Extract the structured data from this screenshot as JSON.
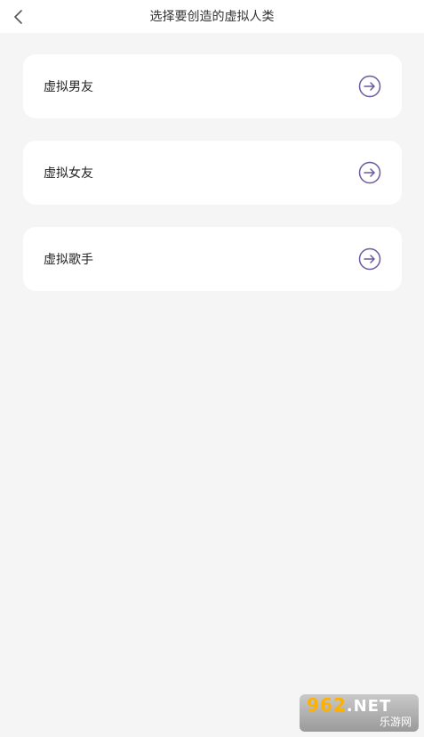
{
  "header": {
    "title": "选择要创造的虚拟人类",
    "back_icon": "chevron-left-icon"
  },
  "cards": [
    {
      "label": "虚拟男友",
      "icon": "arrow-right-circle-icon"
    },
    {
      "label": "虚拟女友",
      "icon": "arrow-right-circle-icon"
    },
    {
      "label": "虚拟歌手",
      "icon": "arrow-right-circle-icon"
    }
  ],
  "watermark": {
    "number": "962",
    "suffix": ".NET",
    "subtitle": "乐游网"
  },
  "colors": {
    "background": "#f5f5f5",
    "card": "#ffffff",
    "accent": "#6a5a9e"
  }
}
